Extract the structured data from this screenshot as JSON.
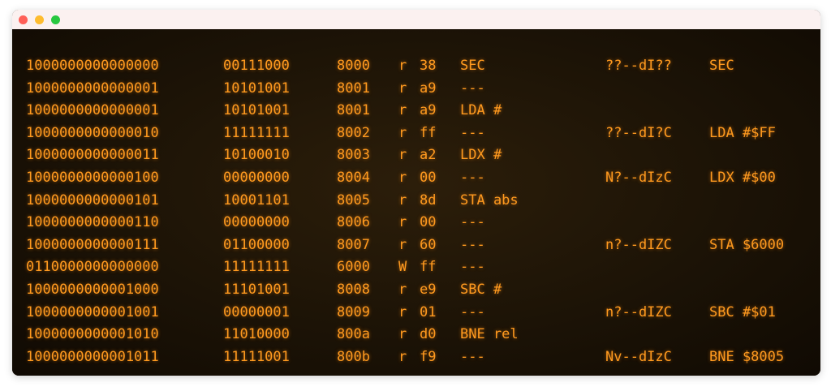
{
  "window": {
    "controls": {
      "close": "close-dot",
      "minimize": "minimize-dot",
      "maximize": "maximize-dot"
    },
    "colors": {
      "titlebar": "#fbf1f0",
      "background": "#1d1406",
      "text": "#ff9a1f"
    }
  },
  "trace": {
    "rows": [
      {
        "addr": "1000000000000000",
        "data": "00111000",
        "hex": "8000",
        "rw": "r",
        "byte": "38",
        "op": "SEC",
        "flags": "??--dI??",
        "dis": "SEC"
      },
      {
        "addr": "1000000000000001",
        "data": "10101001",
        "hex": "8001",
        "rw": "r",
        "byte": "a9",
        "op": "---",
        "flags": "",
        "dis": ""
      },
      {
        "addr": "1000000000000001",
        "data": "10101001",
        "hex": "8001",
        "rw": "r",
        "byte": "a9",
        "op": "LDA #",
        "flags": "",
        "dis": ""
      },
      {
        "addr": "1000000000000010",
        "data": "11111111",
        "hex": "8002",
        "rw": "r",
        "byte": "ff",
        "op": "---",
        "flags": "??--dI?C",
        "dis": "LDA #$FF"
      },
      {
        "addr": "1000000000000011",
        "data": "10100010",
        "hex": "8003",
        "rw": "r",
        "byte": "a2",
        "op": "LDX #",
        "flags": "",
        "dis": ""
      },
      {
        "addr": "1000000000000100",
        "data": "00000000",
        "hex": "8004",
        "rw": "r",
        "byte": "00",
        "op": "---",
        "flags": "N?--dIzC",
        "dis": "LDX #$00"
      },
      {
        "addr": "1000000000000101",
        "data": "10001101",
        "hex": "8005",
        "rw": "r",
        "byte": "8d",
        "op": "STA abs",
        "flags": "",
        "dis": ""
      },
      {
        "addr": "1000000000000110",
        "data": "00000000",
        "hex": "8006",
        "rw": "r",
        "byte": "00",
        "op": "---",
        "flags": "",
        "dis": ""
      },
      {
        "addr": "1000000000000111",
        "data": "01100000",
        "hex": "8007",
        "rw": "r",
        "byte": "60",
        "op": "---",
        "flags": "n?--dIZC",
        "dis": "STA $6000"
      },
      {
        "addr": "0110000000000000",
        "data": "11111111",
        "hex": "6000",
        "rw": "W",
        "byte": "ff",
        "op": "---",
        "flags": "",
        "dis": ""
      },
      {
        "addr": "1000000000001000",
        "data": "11101001",
        "hex": "8008",
        "rw": "r",
        "byte": "e9",
        "op": "SBC #",
        "flags": "",
        "dis": ""
      },
      {
        "addr": "1000000000001001",
        "data": "00000001",
        "hex": "8009",
        "rw": "r",
        "byte": "01",
        "op": "---",
        "flags": "n?--dIZC",
        "dis": "SBC #$01"
      },
      {
        "addr": "1000000000001010",
        "data": "11010000",
        "hex": "800a",
        "rw": "r",
        "byte": "d0",
        "op": "BNE rel",
        "flags": "",
        "dis": ""
      },
      {
        "addr": "1000000000001011",
        "data": "11111001",
        "hex": "800b",
        "rw": "r",
        "byte": "f9",
        "op": "---",
        "flags": "Nv--dIzC",
        "dis": "BNE $8005"
      }
    ]
  }
}
